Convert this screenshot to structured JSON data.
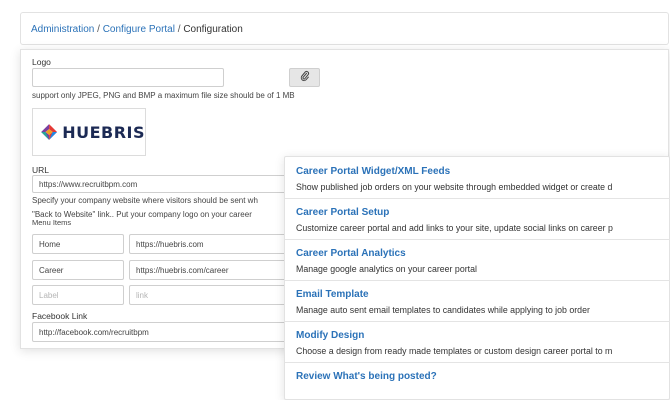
{
  "breadcrumb": {
    "administration": "Administration",
    "separator": " / ",
    "configure_portal": "Configure Portal",
    "current": "Configuration"
  },
  "logo_section": {
    "label": "Logo",
    "file_value": "",
    "attach_icon": "paperclip-icon",
    "support_note": "support only JPEG, PNG and BMP a maximum file size should be of 1 MB",
    "logo_text": "HUEBRIS"
  },
  "url_section": {
    "label": "URL",
    "value": "https://www.recruitbpm.com",
    "help_line1": "Specify your company website where visitors should be sent wh",
    "help_line2": "\"Back to Website\" link.. Put your company logo on your career",
    "menu_items_label": "Menu Items"
  },
  "menu_rows": [
    {
      "label": "Home",
      "link": "https://huebris.com"
    },
    {
      "label": "Career",
      "link": "https://huebris.com/career"
    },
    {
      "label_placeholder": "Label",
      "link_placeholder": "link"
    }
  ],
  "facebook": {
    "label": "Facebook Link",
    "value": "http://facebook.com/recruitbpm"
  },
  "popup": {
    "items": [
      {
        "title": "Career Portal Widget/XML Feeds",
        "desc": "Show published job orders on your website through embedded widget or create d"
      },
      {
        "title": "Career Portal Setup",
        "desc": "Customize career portal and add links to your site, update social links on career p"
      },
      {
        "title": "Career Portal Analytics",
        "desc": "Manage google analytics on your career portal"
      },
      {
        "title": "Email Template",
        "desc": "Manage auto sent email templates to candidates while applying to job order"
      },
      {
        "title": "Modify Design",
        "desc": "Choose a design from ready made templates or custom design career portal to m"
      },
      {
        "title": "Review What's being posted?"
      }
    ]
  },
  "colors": {
    "link_blue": "#2b72b8",
    "logo_navy": "#1c2a54"
  }
}
